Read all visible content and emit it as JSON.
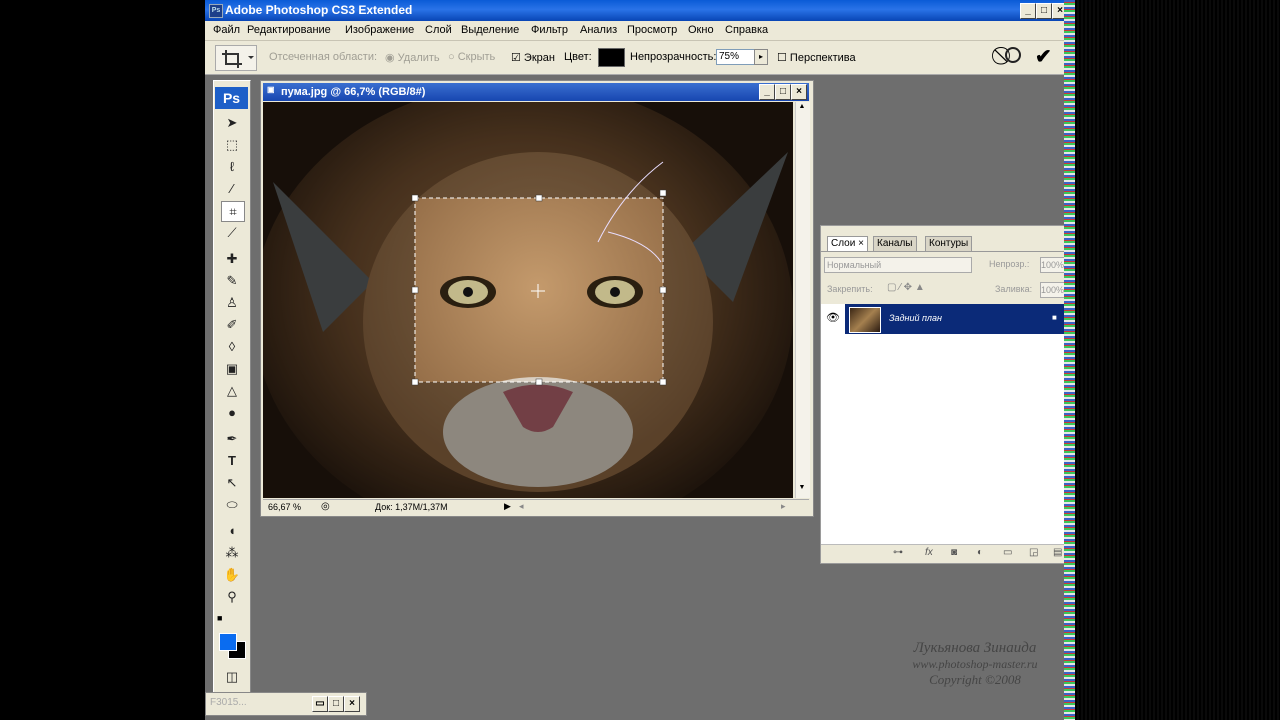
{
  "app": {
    "title": "Adobe Photoshop CS3 Extended",
    "ps_badge": "Ps"
  },
  "menu": [
    "Файл",
    "Редактирование",
    "Изображение",
    "Слой",
    "Выделение",
    "Фильтр",
    "Анализ",
    "Просмотр",
    "Окно",
    "Справка"
  ],
  "options": {
    "shielded_area": "Отсеченная области:",
    "delete": "Удалить",
    "hide": "Скрыть",
    "screen": "Экран",
    "color": "Цвет:",
    "opacity_label": "Непрозрачность:",
    "opacity_value": "75%",
    "perspective": "Перспектива",
    "shield_color": "#000000"
  },
  "document": {
    "title": "пума.jpg @ 66,7% (RGB/8#)",
    "zoom": "66,67 %",
    "doc_info": "Док: 1,37M/1,37M"
  },
  "layers_panel": {
    "tabs": [
      "Слои",
      "Каналы",
      "Контуры"
    ],
    "blend_mode": "Нормальный",
    "opacity_label": "Непрозр.:",
    "opacity_value": "100%",
    "lock_label": "Закрепить:",
    "fill_label": "Заливка:",
    "fill_value": "100%",
    "layer_name": "Задний план"
  },
  "colors": {
    "foreground": "#0a6cf0",
    "background": "#000000"
  },
  "minimized_window": "F3015...",
  "signature": {
    "name": "Лукьянова Зинаида",
    "url": "www.photoshop-master.ru",
    "copyright": "Copyright ©2008"
  }
}
